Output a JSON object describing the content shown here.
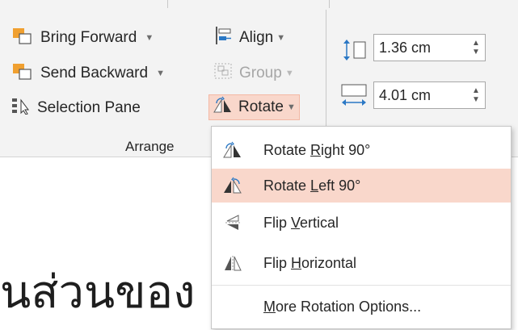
{
  "ribbon": {
    "arrange": {
      "bring_forward": "Bring Forward",
      "send_backward": "Send Backward",
      "selection_pane": "Selection Pane",
      "align": "Align",
      "group": "Group",
      "rotate": "Rotate",
      "group_label": "Arrange"
    },
    "size": {
      "height_value": "1.36 cm",
      "width_value": "4.01 cm"
    }
  },
  "rotate_menu": {
    "items": [
      {
        "pre": "Rotate ",
        "key": "R",
        "post": "ight 90°",
        "icon": "rotate-right-icon"
      },
      {
        "pre": "Rotate ",
        "key": "L",
        "post": "eft 90°",
        "icon": "rotate-left-icon"
      },
      {
        "pre": "Flip ",
        "key": "V",
        "post": "ertical",
        "icon": "flip-vertical-icon"
      },
      {
        "pre": "Flip ",
        "key": "H",
        "post": "orizontal",
        "icon": "flip-horizontal-icon"
      },
      {
        "pre": "",
        "key": "M",
        "post": "ore Rotation Options...",
        "icon": ""
      }
    ],
    "highlighted_index": 1
  },
  "document": {
    "text": "นส่วนของ"
  },
  "colors": {
    "highlight": "#f9d7cb",
    "accent_orange": "#f0a030",
    "accent_blue": "#2b78c5",
    "ribbon_bg": "#f3f3f3"
  }
}
